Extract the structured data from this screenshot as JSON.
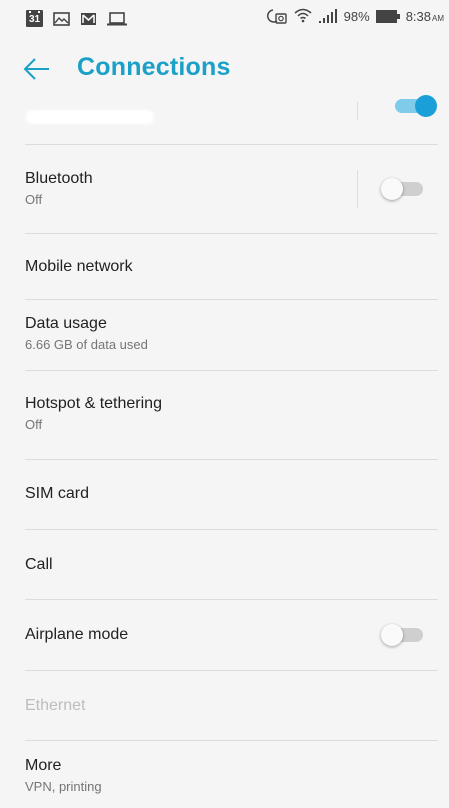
{
  "status_bar": {
    "calendar_day": "31",
    "battery_percent": "98%",
    "time": "8:38",
    "ampm": "AM",
    "icons_left": [
      "calendar-icon",
      "image-icon",
      "gmail-icon",
      "laptop-icon"
    ],
    "icons_right": [
      "alarm-icon",
      "wifi-icon",
      "signal-icon",
      "battery-icon"
    ]
  },
  "header": {
    "title": "Connections",
    "accent_color": "#1ba0c8"
  },
  "settings": {
    "wifi": {
      "toggle_on": true
    },
    "bluetooth": {
      "title": "Bluetooth",
      "subtitle": "Off",
      "toggle_on": false
    },
    "mobile_network": {
      "title": "Mobile network"
    },
    "data_usage": {
      "title": "Data usage",
      "subtitle": "6.66 GB of data used"
    },
    "hotspot": {
      "title": "Hotspot & tethering",
      "subtitle": "Off"
    },
    "sim_card": {
      "title": "SIM card"
    },
    "call": {
      "title": "Call"
    },
    "airplane_mode": {
      "title": "Airplane mode",
      "toggle_on": false
    },
    "ethernet": {
      "title": "Ethernet",
      "disabled": true
    },
    "more": {
      "title": "More",
      "subtitle": "VPN, printing"
    }
  }
}
